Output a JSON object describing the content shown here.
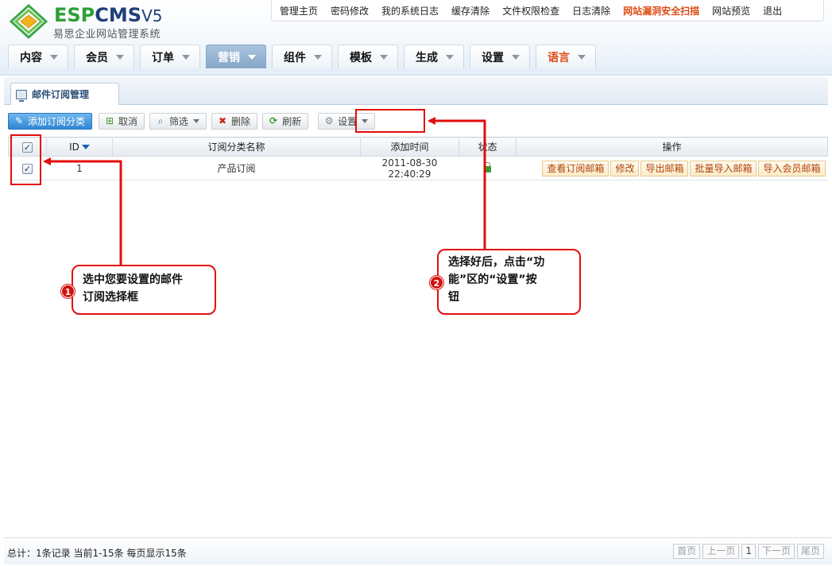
{
  "brand": {
    "logo_prefix": "ESP",
    "logo_cms": "CMS",
    "logo_version": "V5",
    "subtitle": "易思企业网站管理系统"
  },
  "topnav": [
    {
      "label": "管理主页",
      "hot": false
    },
    {
      "label": "密码修改",
      "hot": false
    },
    {
      "label": "我的系统日志",
      "hot": false
    },
    {
      "label": "缓存清除",
      "hot": false
    },
    {
      "label": "文件权限检查",
      "hot": false
    },
    {
      "label": "日志清除",
      "hot": false
    },
    {
      "label": "网站漏洞安全扫描",
      "hot": true
    },
    {
      "label": "网站预览",
      "hot": false
    },
    {
      "label": "退出",
      "hot": false
    }
  ],
  "mainnav": [
    {
      "label": "内容",
      "active": false
    },
    {
      "label": "会员",
      "active": false
    },
    {
      "label": "订单",
      "active": false
    },
    {
      "label": "营销",
      "active": true
    },
    {
      "label": "组件",
      "active": false
    },
    {
      "label": "模板",
      "active": false
    },
    {
      "label": "生成",
      "active": false
    },
    {
      "label": "设置",
      "active": false
    },
    {
      "label": "语言",
      "active": false
    }
  ],
  "page_tab": {
    "label": "邮件订阅管理"
  },
  "toolbar": {
    "add": "添加订阅分类",
    "cancel": "取消",
    "filter": "筛选",
    "delete": "删除",
    "refresh": "刷新",
    "settings": "设置"
  },
  "table": {
    "headers": {
      "id": "ID",
      "name": "订阅分类名称",
      "time": "添加时间",
      "status": "状态",
      "ops": "操作"
    },
    "rows": [
      {
        "checked": true,
        "id": "1",
        "name": "产品订阅",
        "time": "2011-08-30 22:40:29",
        "status": "unlocked",
        "ops": [
          "查看订阅邮箱",
          "修改",
          "导出邮箱",
          "批量导入邮箱",
          "导入会员邮箱"
        ]
      }
    ]
  },
  "annotations": {
    "callout1": {
      "num": "1",
      "line1": "选中您要设置的邮件",
      "line2": "订阅选择框"
    },
    "callout2": {
      "num": "2",
      "line1": "选择好后，点击“功",
      "line2": "能”区的“设置”按",
      "line3": "钮"
    }
  },
  "footer": {
    "summary": "总计：1条记录 当前1-15条 每页显示15条",
    "pager": {
      "first": "首页",
      "prev": "上一页",
      "current": "1",
      "next": "下一页",
      "last": "尾页"
    }
  },
  "colors": {
    "accent": "#2f86d4",
    "highlight": "#e30d0d",
    "hot_link": "#e04b16"
  }
}
